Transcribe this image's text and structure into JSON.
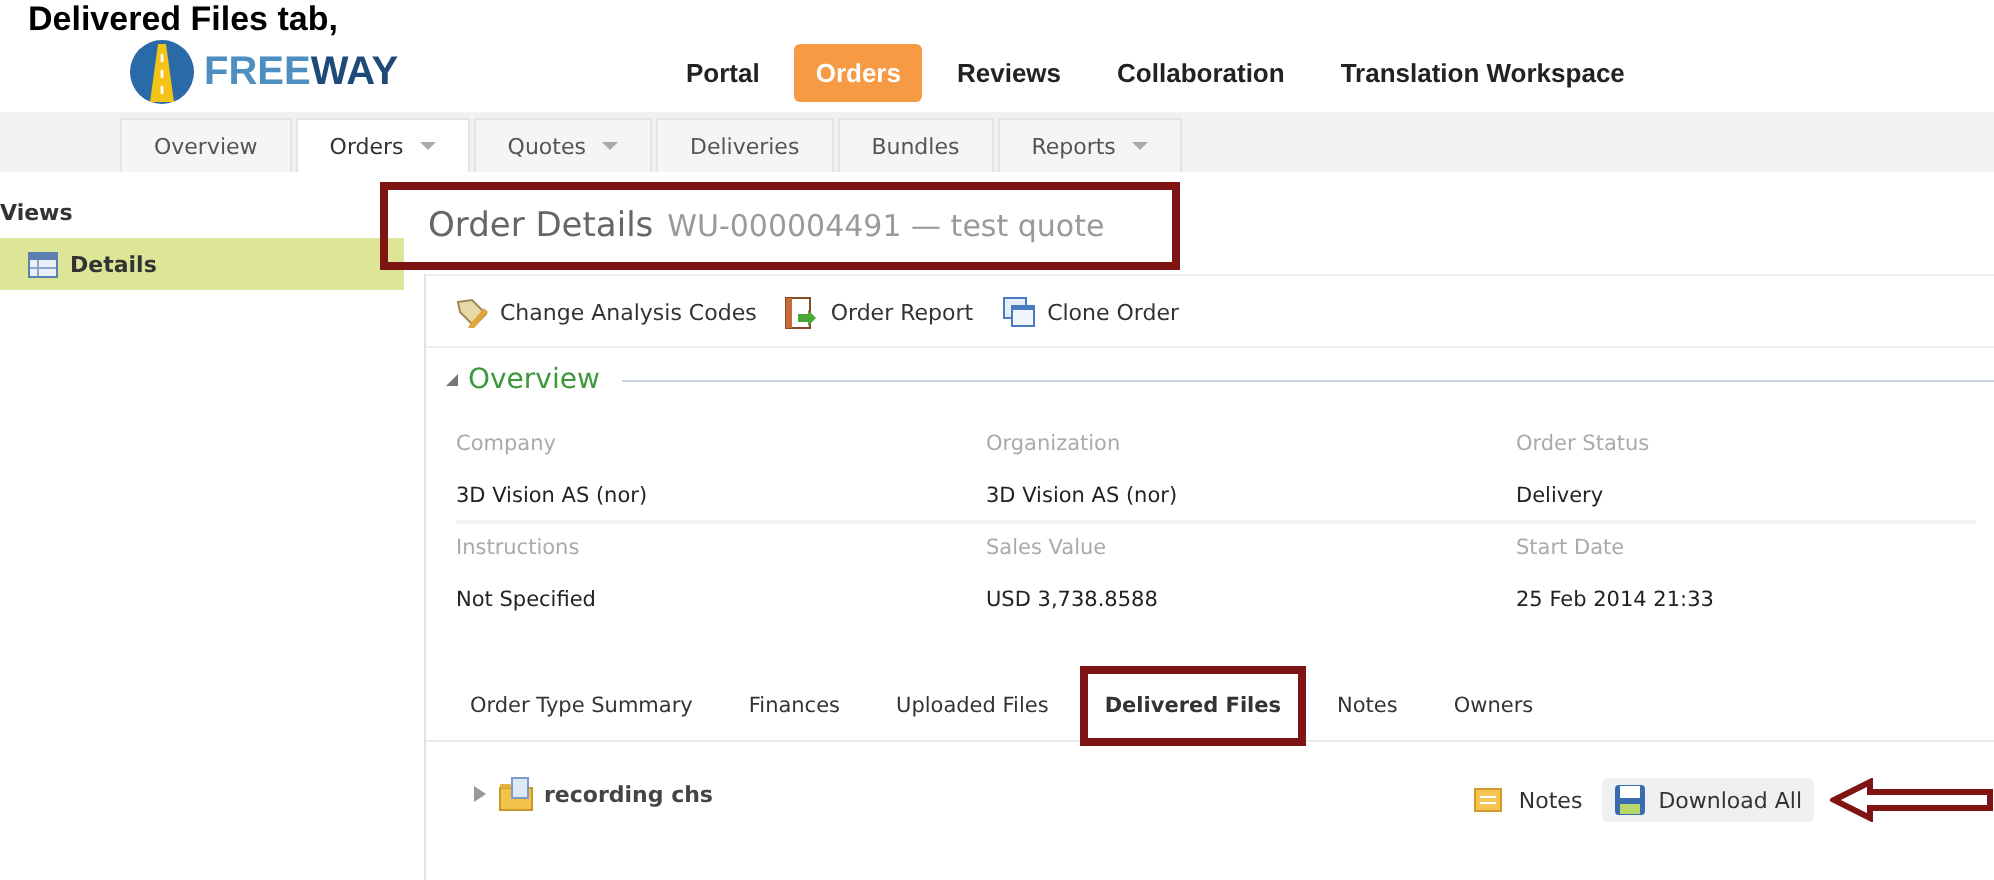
{
  "caption": "Delivered Files tab,",
  "logo": {
    "text_light": "FREE",
    "text_dark": "WAY"
  },
  "main_nav": [
    {
      "label": "Portal",
      "selected": false
    },
    {
      "label": "Orders",
      "selected": true
    },
    {
      "label": "Reviews",
      "selected": false
    },
    {
      "label": "Collaboration",
      "selected": false
    },
    {
      "label": "Translation Workspace",
      "selected": false
    }
  ],
  "sub_nav": [
    {
      "label": "Overview",
      "selected": false,
      "dropdown": false
    },
    {
      "label": "Orders",
      "selected": true,
      "dropdown": true
    },
    {
      "label": "Quotes",
      "selected": false,
      "dropdown": true
    },
    {
      "label": "Deliveries",
      "selected": false,
      "dropdown": false
    },
    {
      "label": "Bundles",
      "selected": false,
      "dropdown": false
    },
    {
      "label": "Reports",
      "selected": false,
      "dropdown": true
    }
  ],
  "sidebar": {
    "heading": "Views",
    "items": [
      {
        "label": "Details",
        "selected": true
      }
    ]
  },
  "page_title": {
    "title": "Order Details",
    "subtitle": "WU-000004491 — test quote",
    "highlighted": true
  },
  "toolbar": [
    {
      "kind": "tag",
      "label": "Change Analysis Codes"
    },
    {
      "kind": "report",
      "label": "Order Report"
    },
    {
      "kind": "clone",
      "label": "Clone Order"
    }
  ],
  "overview": {
    "heading": "Overview",
    "expanded": true,
    "fields": [
      {
        "label": "Company",
        "value": "3D Vision AS (nor)"
      },
      {
        "label": "Organization",
        "value": "3D Vision AS (nor)"
      },
      {
        "label": "Order Status",
        "value": "Delivery"
      },
      {
        "label": "Instructions",
        "value": "Not Specified"
      },
      {
        "label": "Sales Value",
        "value": "USD 3,738.8588"
      },
      {
        "label": "Start Date",
        "value": "25 Feb 2014 21:33"
      }
    ]
  },
  "detail_tabs": [
    {
      "label": "Order Type Summary",
      "selected": false,
      "highlighted": false
    },
    {
      "label": "Finances",
      "selected": false,
      "highlighted": false
    },
    {
      "label": "Uploaded Files",
      "selected": false,
      "highlighted": false
    },
    {
      "label": "Delivered Files",
      "selected": true,
      "highlighted": true
    },
    {
      "label": "Notes",
      "selected": false,
      "highlighted": false
    },
    {
      "label": "Owners",
      "selected": false,
      "highlighted": false
    }
  ],
  "files": [
    {
      "name": "recording chs",
      "expanded": false
    }
  ],
  "actions": {
    "notes": "Notes",
    "download": "Download All",
    "arrow": true
  }
}
